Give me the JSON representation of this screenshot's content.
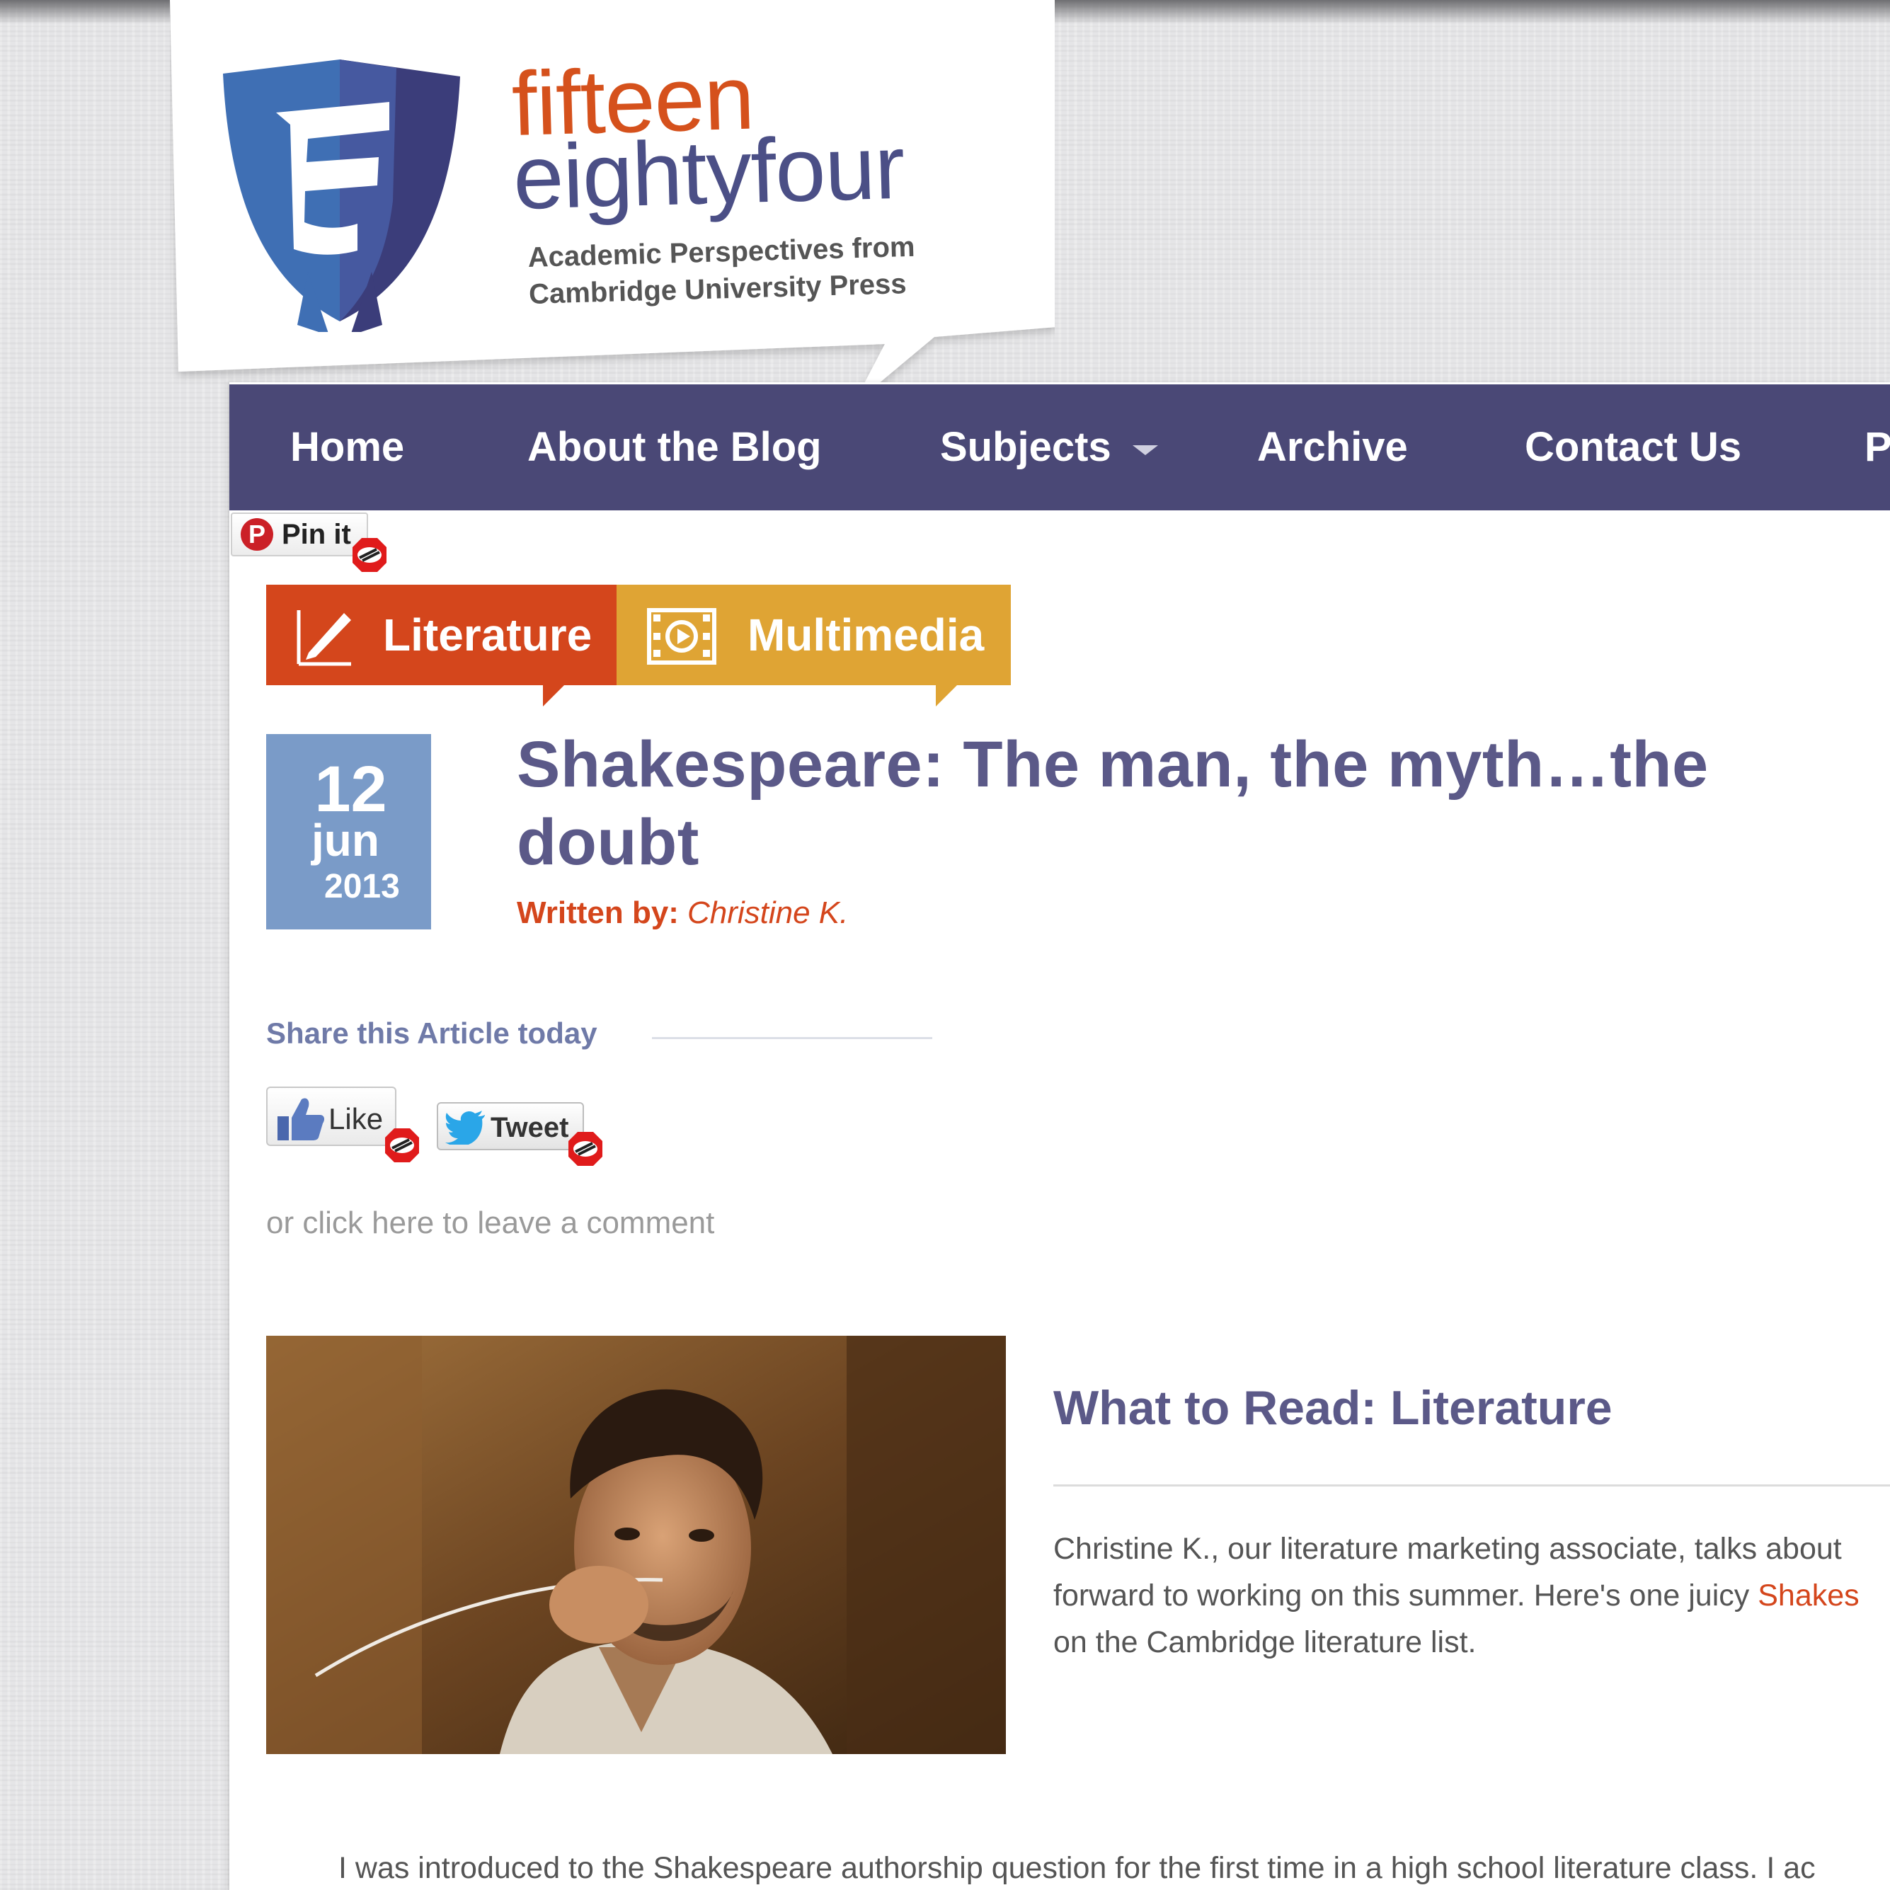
{
  "brand": {
    "line1": "fifteen",
    "line2": "eightyfour",
    "tagline_line1": "Academic Perspectives from",
    "tagline_line2": "Cambridge University Press"
  },
  "nav": {
    "items": [
      "Home",
      "About the Blog",
      "Subjects",
      "Archive",
      "Contact Us",
      "P"
    ]
  },
  "pin": {
    "label": "Pin it"
  },
  "categories": [
    {
      "label": "Literature",
      "color": "#d4461c"
    },
    {
      "label": "Multimedia",
      "color": "#dfa434"
    }
  ],
  "post": {
    "date": {
      "day": "12",
      "month": "jun",
      "year": "2013"
    },
    "title": "Shakespeare: The man, the myth…the doubt",
    "byline_label": "Written by:",
    "author": "Christine K."
  },
  "share": {
    "heading": "Share this Article today",
    "like_label": "Like",
    "tweet_label": "Tweet",
    "comment_link": "or click here to leave a comment"
  },
  "read": {
    "heading": "What to Read: Literature",
    "summary_line1": "Christine K., our literature marketing associate, talks about",
    "summary_line2_a": "forward to working on this summer. Here's one juicy ",
    "summary_line2_link": "Shakes",
    "summary_line3": "on the Cambridge literature list."
  },
  "body": {
    "first_line": "I was introduced to the Shakespeare authorship question for the first time in a high school literature class. I ac"
  },
  "colors": {
    "nav_bg": "#4a4876",
    "accent_orange": "#d4461c",
    "accent_gold": "#dfa434",
    "title_purple": "#5b5988",
    "date_blue": "#7a9bc8"
  }
}
